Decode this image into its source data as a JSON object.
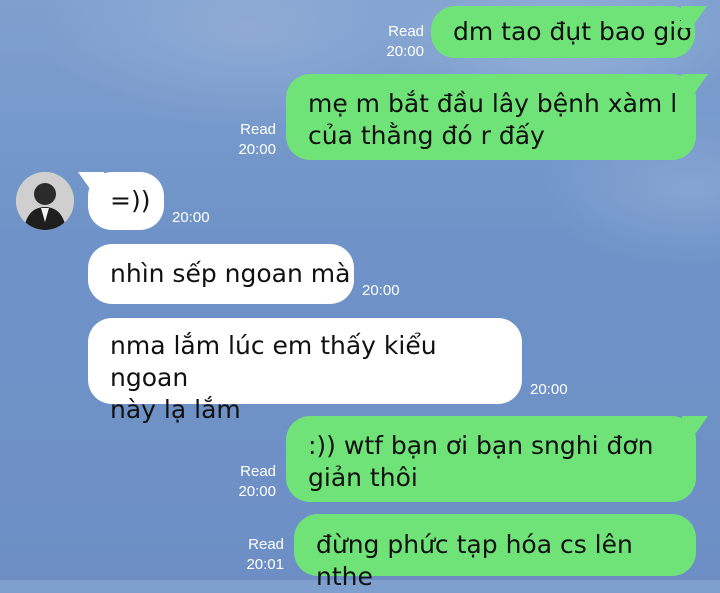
{
  "messages": [
    {
      "id": "m1",
      "type": "outgoing",
      "text": "dm tao đụt bao giờ",
      "read": "Read",
      "time": "20:00"
    },
    {
      "id": "m2",
      "type": "outgoing",
      "lines": [
        "mẹ m bắt đầu lây bệnh xàm l",
        "của thằng đó r đấy"
      ],
      "read": "Read",
      "time": "20:00"
    },
    {
      "id": "m3",
      "type": "incoming",
      "text": "=))",
      "time": "20:00"
    },
    {
      "id": "m4",
      "type": "incoming",
      "text": "nhìn sếp ngoan mà",
      "time": "20:00"
    },
    {
      "id": "m5",
      "type": "incoming",
      "lines": [
        "nma lắm lúc em thấy kiểu ngoan",
        "này lạ lắm"
      ],
      "time": "20:00"
    },
    {
      "id": "m6",
      "type": "outgoing",
      "lines": [
        ":)) wtf bạn ơi bạn snghi đơn",
        "giản thôi"
      ],
      "read": "Read",
      "time": "20:00"
    },
    {
      "id": "m7",
      "type": "outgoing",
      "text": "đừng phức tạp hóa cs lên nthe",
      "read": "Read",
      "time": "20:01"
    }
  ],
  "colors": {
    "outgoing_bubble": "#6fe378",
    "incoming_bubble": "#ffffff",
    "background": "#7397c9"
  },
  "avatar": {
    "icon": "person-avatar-icon"
  }
}
